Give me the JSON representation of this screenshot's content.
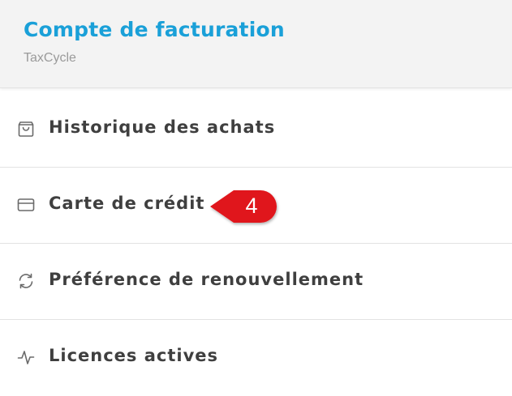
{
  "header": {
    "title": "Compte de facturation",
    "subtitle": "TaxCycle"
  },
  "menu": {
    "items": [
      {
        "label": "Historique des achats",
        "icon": "shopping-bag-icon"
      },
      {
        "label": "Carte de crédit",
        "icon": "credit-card-icon"
      },
      {
        "label": "Préférence de renouvellement",
        "icon": "refresh-icon"
      },
      {
        "label": "Licences actives",
        "icon": "activity-icon"
      }
    ]
  },
  "callout": {
    "number": "4",
    "color": "#e0141b"
  },
  "colors": {
    "accent": "#1aa0d8",
    "header_bg": "#f3f3f3",
    "text": "#3f3f3f",
    "subtitle": "#9a9a9a"
  }
}
